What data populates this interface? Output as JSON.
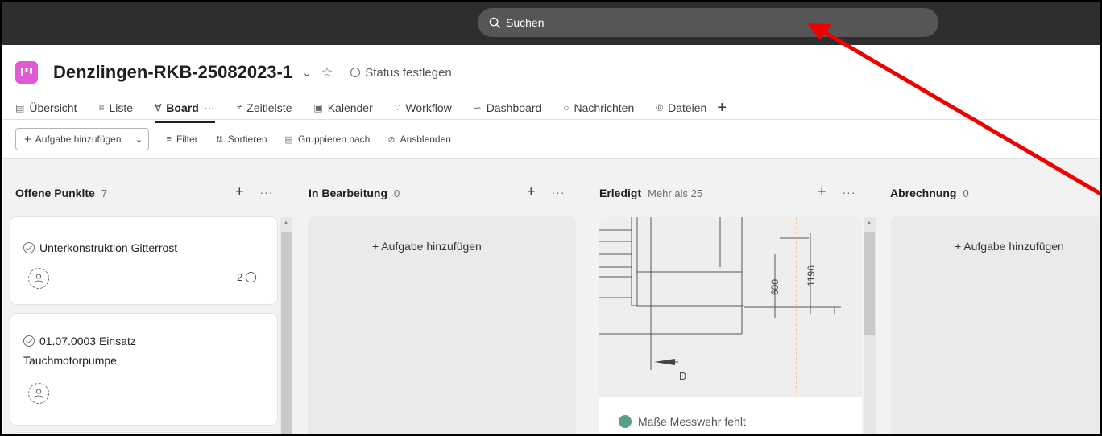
{
  "search": {
    "label": "Suchen"
  },
  "project": {
    "title": "Denzlingen-RKB-25082023-1",
    "status_label": "Status festlegen"
  },
  "tabs": [
    {
      "label": "Übersicht",
      "icon": "overview-icon"
    },
    {
      "label": "Liste",
      "icon": "list-icon"
    },
    {
      "label": "Board",
      "icon": "board-icon",
      "active": true
    },
    {
      "label": "Zeitleiste",
      "icon": "timeline-icon"
    },
    {
      "label": "Kalender",
      "icon": "calendar-icon"
    },
    {
      "label": "Workflow",
      "icon": "workflow-icon"
    },
    {
      "label": "Dashboard",
      "icon": "dashboard-icon"
    },
    {
      "label": "Nachrichten",
      "icon": "message-icon"
    },
    {
      "label": "Dateien",
      "icon": "files-icon"
    }
  ],
  "toolbar": {
    "add_task": "Aufgabe hinzufügen",
    "filter": "Filter",
    "sort": "Sortieren",
    "group": "Gruppieren nach",
    "hide": "Ausblenden"
  },
  "columns": [
    {
      "title": "Offene Punklte",
      "count": "7",
      "cards": [
        {
          "title": "Unterkonstruktion Gitterrost",
          "comments": "2"
        },
        {
          "title_line1": "01.07.0003 Einsatz",
          "title_line2": "Tauchmotorpumpe"
        }
      ]
    },
    {
      "title": "In Bearbeitung",
      "count": "0",
      "add_task": "+ Aufgabe hinzufügen"
    },
    {
      "title": "Erledigt",
      "count": "Mehr als 25",
      "cards": [
        {
          "title": "Maße Messwehr fehlt",
          "drawing_labels": [
            "600",
            "1196",
            "D"
          ]
        }
      ]
    },
    {
      "title": "Abrechnung",
      "count": "0",
      "add_task": "+ Aufgabe hinzufügen"
    }
  ],
  "colors": {
    "topbar": "#2e2e30",
    "project_icon": "#e05ad6",
    "complete_green": "#58a182",
    "annotation_arrow": "#ee0000"
  }
}
